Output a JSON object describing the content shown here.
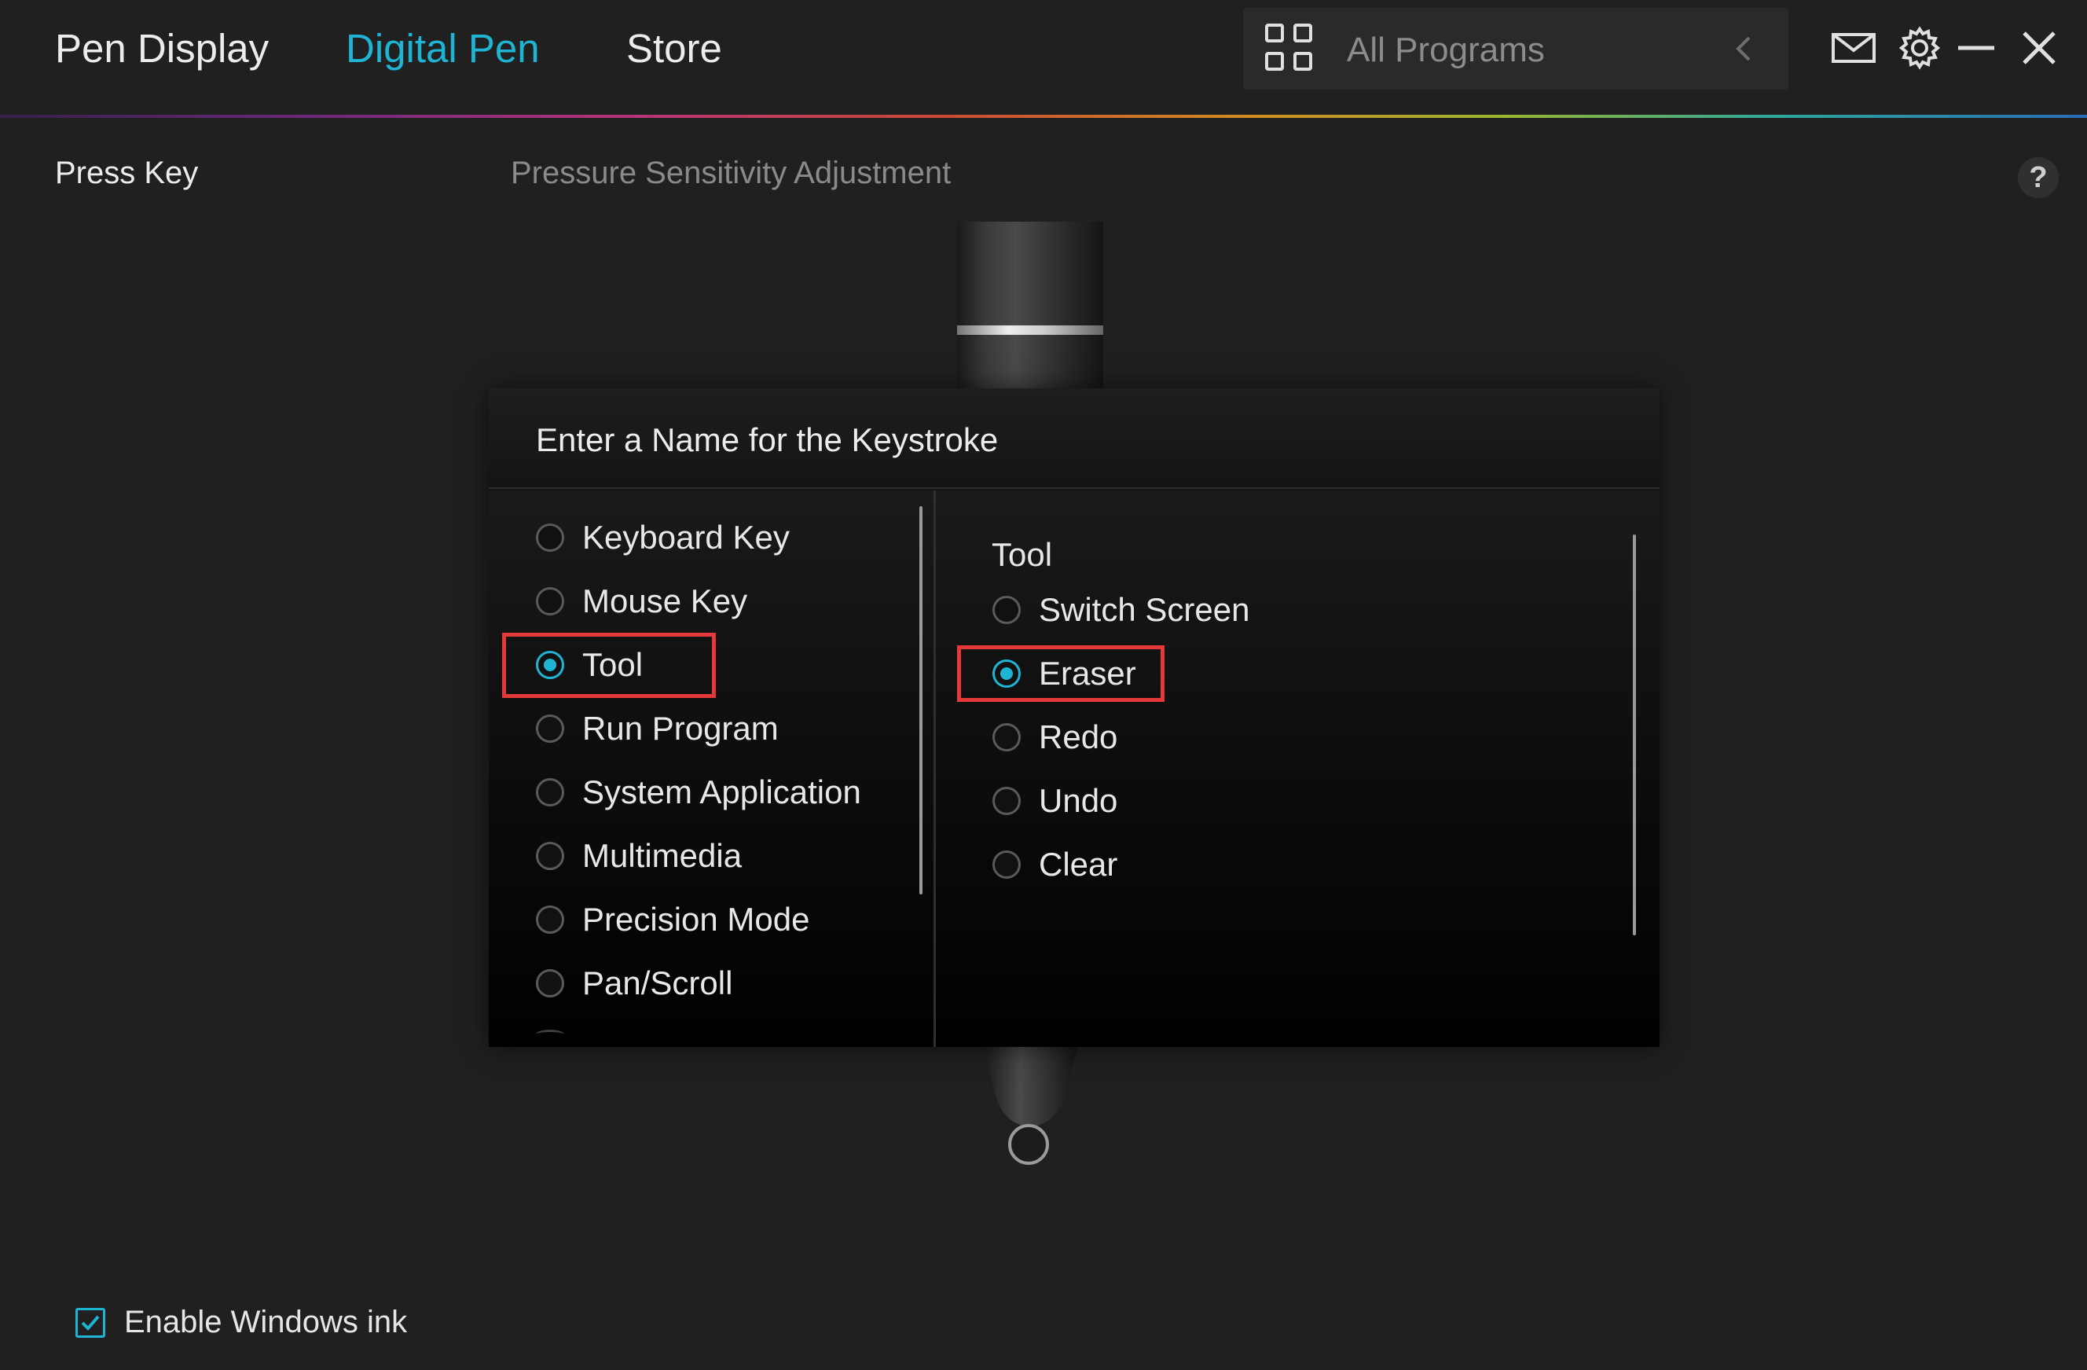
{
  "nav": {
    "tabs": [
      {
        "label": "Pen Display",
        "active": false
      },
      {
        "label": "Digital Pen",
        "active": true
      },
      {
        "label": "Store",
        "active": false
      }
    ],
    "program_selector": {
      "label": "All Programs",
      "icon": "grid-icon"
    },
    "window_icons": [
      "mail-icon",
      "gear-icon",
      "minimize-icon",
      "close-icon"
    ]
  },
  "sections": {
    "press_key": "Press Key",
    "pressure_title": "Pressure Sensitivity Adjustment",
    "help": "?"
  },
  "dialog": {
    "title": "Enter a Name for the Keystroke",
    "left_options": [
      {
        "label": "Keyboard Key",
        "selected": false
      },
      {
        "label": "Mouse Key",
        "selected": false
      },
      {
        "label": "Tool",
        "selected": true
      },
      {
        "label": "Run Program",
        "selected": false
      },
      {
        "label": "System Application",
        "selected": false
      },
      {
        "label": "Multimedia",
        "selected": false
      },
      {
        "label": "Precision Mode",
        "selected": false
      },
      {
        "label": "Pan/Scroll",
        "selected": false
      }
    ],
    "right_group_label": "Tool",
    "right_options": [
      {
        "label": "Switch Screen",
        "selected": false
      },
      {
        "label": "Eraser",
        "selected": true
      },
      {
        "label": "Redo",
        "selected": false
      },
      {
        "label": "Undo",
        "selected": false
      },
      {
        "label": "Clear",
        "selected": false
      }
    ]
  },
  "footer": {
    "windows_ink_label": "Enable Windows ink",
    "windows_ink_checked": true
  },
  "colors": {
    "accent": "#1fb4d4",
    "highlight": "#e5383b",
    "background": "#202020"
  }
}
